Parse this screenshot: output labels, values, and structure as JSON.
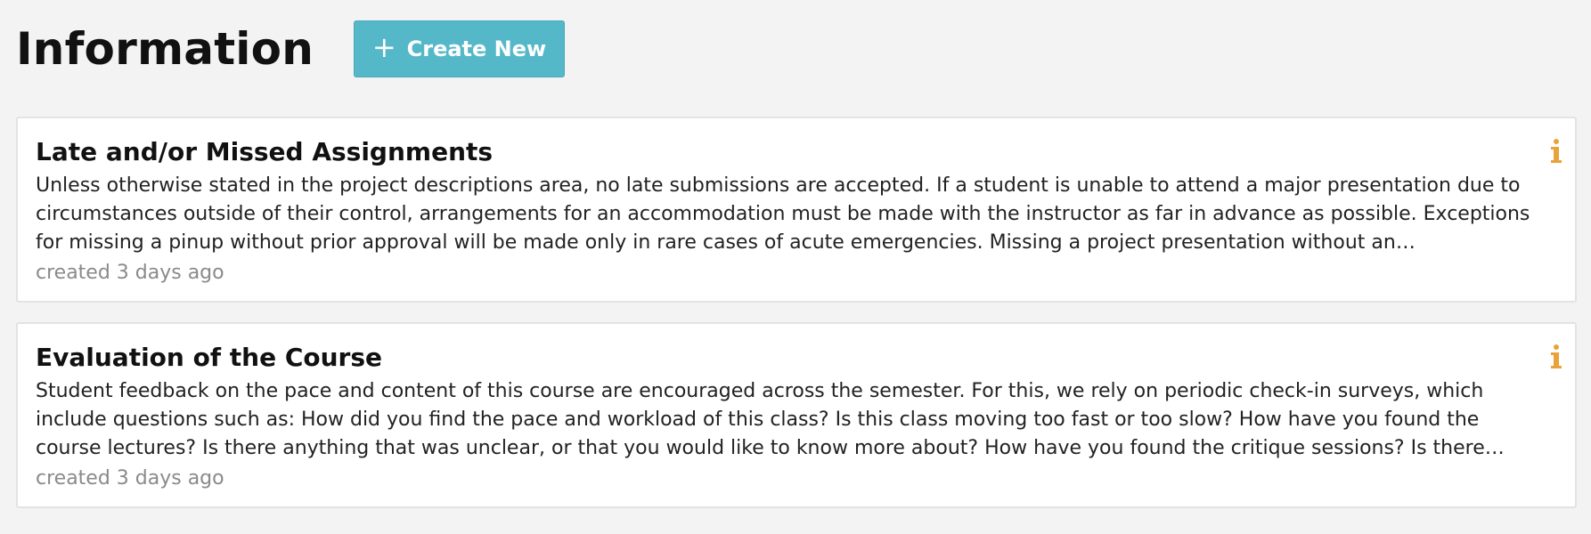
{
  "header": {
    "title": "Information",
    "create_button_label": "Create New",
    "create_button_icon": "plus-icon"
  },
  "colors": {
    "accent": "#55b8c9",
    "info_icon": "#e8a33a",
    "meta_text": "#8a8a8a"
  },
  "cards": [
    {
      "title": "Late and/or Missed Assignments",
      "body": "Unless otherwise stated in the project descriptions area, no late submissions are accepted. If a student is unable to attend a major presentation due to circumstances outside of their control, arrangements for an accommodation must be made with the instructor as far in advance as possible. Exceptions for missing a pinup without prior approval will be made only in rare cases of acute emergencies. Missing a project presentation without an accommodation or…",
      "meta": "created 3 days ago",
      "icon": "info-icon"
    },
    {
      "title": "Evaluation of the Course",
      "body": "Student feedback on the pace and content of this course are encouraged across the semester. For this, we rely on periodic check-in surveys, which include questions such as: How did you find the pace and workload of this class? Is this class moving too fast or too slow? How have you found the course lectures? Is there anything that was unclear, or that you would like to know more about? How have you found the critique sessions? Is there anything about the way this…",
      "meta": "created 3 days ago",
      "icon": "info-icon"
    }
  ]
}
